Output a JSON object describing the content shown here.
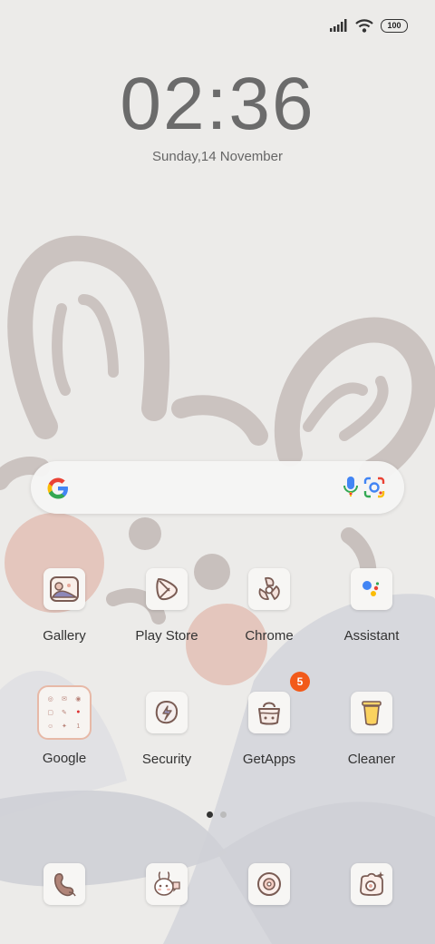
{
  "status_bar": {
    "battery": "100",
    "signal_icon": "signal-icon",
    "wifi_icon": "wifi-icon"
  },
  "lock": {
    "time": "02:36",
    "date": "Sunday,14 November"
  },
  "search": {
    "logo": "google-logo-icon",
    "mic": "microphone-icon",
    "lens": "camera-lens-icon"
  },
  "apps": [
    {
      "label": "Gallery",
      "icon": "gallery-icon"
    },
    {
      "label": "Play Store",
      "icon": "play-store-icon"
    },
    {
      "label": "Chrome",
      "icon": "chrome-icon"
    },
    {
      "label": "Assistant",
      "icon": "assistant-icon"
    },
    {
      "label": "Google",
      "icon": "google-folder-icon"
    },
    {
      "label": "Security",
      "icon": "security-icon"
    },
    {
      "label": "GetApps",
      "icon": "getapps-icon",
      "badge": "5"
    },
    {
      "label": "Cleaner",
      "icon": "cleaner-icon"
    }
  ],
  "dock": [
    {
      "icon": "phone-icon"
    },
    {
      "icon": "messaging-icon"
    },
    {
      "icon": "browser-icon"
    },
    {
      "icon": "camera-icon"
    }
  ],
  "page_indicator": {
    "pages": 2,
    "current": 1
  },
  "colors": {
    "background": "#ecebe9",
    "badge": "#f25a1a",
    "wallpaper_pink": "#e3c0b5",
    "wallpaper_grey": "#cfd0d6"
  }
}
